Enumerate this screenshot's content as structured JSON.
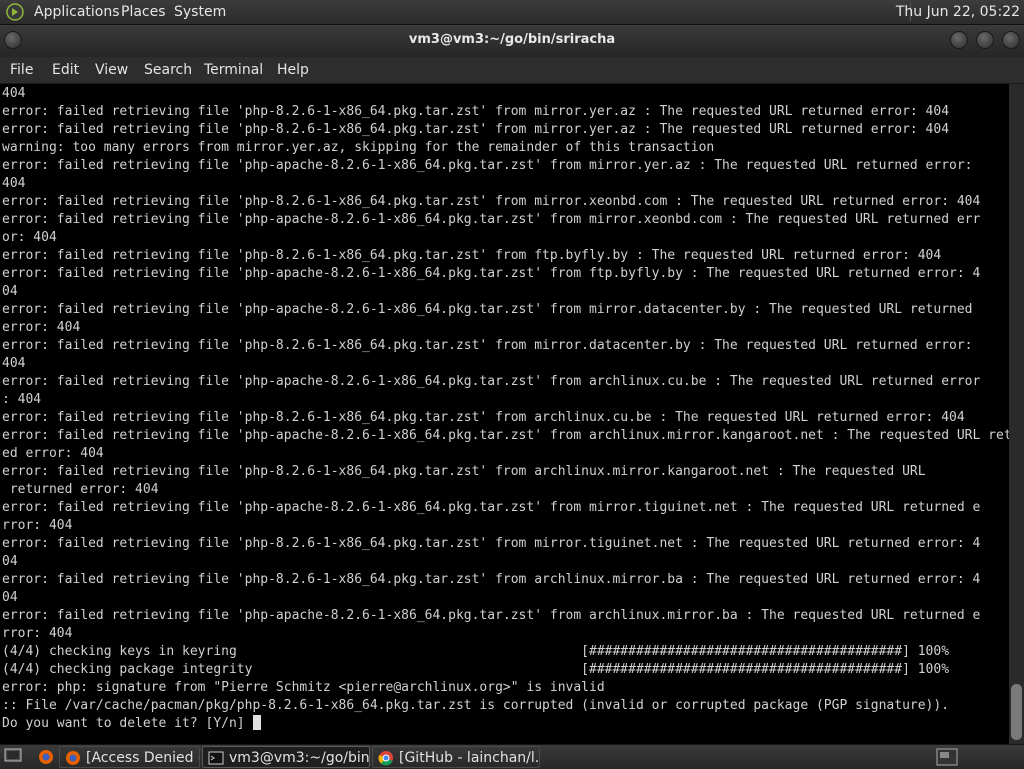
{
  "top_panel": {
    "menus": [
      "Applications",
      "Places",
      "System"
    ],
    "clock": "Thu Jun 22, 05:22"
  },
  "window": {
    "title": "vm3@vm3:~/go/bin/sriracha",
    "menu": [
      "File",
      "Edit",
      "View",
      "Search",
      "Terminal",
      "Help"
    ]
  },
  "terminal": {
    "lines": [
      "404",
      "error: failed retrieving file 'php-8.2.6-1-x86_64.pkg.tar.zst' from mirror.yer.az : The requested URL returned error: 404",
      "error: failed retrieving file 'php-8.2.6-1-x86_64.pkg.tar.zst' from mirror.yer.az : The requested URL returned error: 404",
      "warning: too many errors from mirror.yer.az, skipping for the remainder of this transaction",
      "error: failed retrieving file 'php-apache-8.2.6-1-x86_64.pkg.tar.zst' from mirror.yer.az : The requested URL returned error:",
      "404",
      "error: failed retrieving file 'php-8.2.6-1-x86_64.pkg.tar.zst' from mirror.xeonbd.com : The requested URL returned error: 404",
      "error: failed retrieving file 'php-apache-8.2.6-1-x86_64.pkg.tar.zst' from mirror.xeonbd.com : The requested URL returned err",
      "or: 404",
      "error: failed retrieving file 'php-8.2.6-1-x86_64.pkg.tar.zst' from ftp.byfly.by : The requested URL returned error: 404",
      "error: failed retrieving file 'php-apache-8.2.6-1-x86_64.pkg.tar.zst' from ftp.byfly.by : The requested URL returned error: 4",
      "04",
      "error: failed retrieving file 'php-apache-8.2.6-1-x86_64.pkg.tar.zst' from mirror.datacenter.by : The requested URL returned",
      "error: 404",
      "error: failed retrieving file 'php-8.2.6-1-x86_64.pkg.tar.zst' from mirror.datacenter.by : The requested URL returned error:",
      "404",
      "error: failed retrieving file 'php-apache-8.2.6-1-x86_64.pkg.tar.zst' from archlinux.cu.be : The requested URL returned error",
      ": 404",
      "error: failed retrieving file 'php-8.2.6-1-x86_64.pkg.tar.zst' from archlinux.cu.be : The requested URL returned error: 404",
      "error: failed retrieving file 'php-apache-8.2.6-1-x86_64.pkg.tar.zst' from archlinux.mirror.kangaroot.net : The requested URL return",
      "ed error: 404",
      "error: failed retrieving file 'php-8.2.6-1-x86_64.pkg.tar.zst' from archlinux.mirror.kangaroot.net : The requested URL",
      " returned error: 404",
      "error: failed retrieving file 'php-apache-8.2.6-1-x86_64.pkg.tar.zst' from mirror.tiguinet.net : The requested URL returned e",
      "rror: 404",
      "error: failed retrieving file 'php-8.2.6-1-x86_64.pkg.tar.zst' from mirror.tiguinet.net : The requested URL returned error: 4",
      "04",
      "error: failed retrieving file 'php-8.2.6-1-x86_64.pkg.tar.zst' from archlinux.mirror.ba : The requested URL returned error: 4",
      "04",
      "error: failed retrieving file 'php-apache-8.2.6-1-x86_64.pkg.tar.zst' from archlinux.mirror.ba : The requested URL returned e",
      "rror: 404",
      "(4/4) checking keys in keyring                                            [########################################] 100%",
      "(4/4) checking package integrity                                          [########################################] 100%",
      "error: php: signature from \"Pierre Schmitz <pierre@archlinux.org>\" is invalid",
      ":: File /var/cache/pacman/pkg/php-8.2.6-1-x86_64.pkg.tar.zst is corrupted (invalid or corrupted package (PGP signature)).",
      "Do you want to delete it? [Y/n] "
    ]
  },
  "taskbar": {
    "tasks": [
      {
        "label": "[Access Denied — M...",
        "icon": "firefox-icon"
      },
      {
        "label": "vm3@vm3:~/go/bin...",
        "icon": "terminal-icon"
      },
      {
        "label": "[GitHub - lainchan/l...",
        "icon": "chrome-icon"
      }
    ]
  },
  "colors": {
    "terminal_bg": "#000000",
    "terminal_fg": "#d0d0d0",
    "panel_bg": "#2b2b2b"
  }
}
